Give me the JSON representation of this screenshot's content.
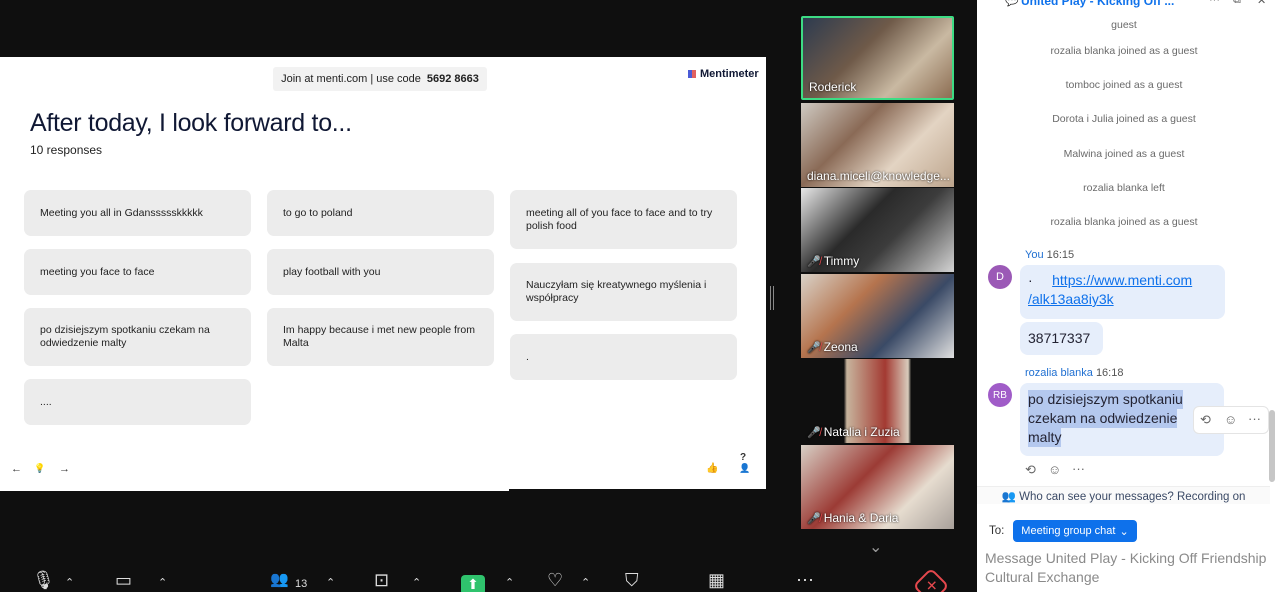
{
  "slide": {
    "join_text": "Join at menti.com | use code",
    "join_code": "5692 8663",
    "brand": "Mentimeter",
    "title": "After today, I look forward to...",
    "subtitle": "10 responses",
    "responses": [
      "Meeting you all in Gdanssssskkkkk",
      "meeting you face to face",
      "po dzisiejszym spotkaniu czekam na odwiedzenie malty",
      "....",
      "to go to poland",
      "play football with you",
      "Im happy because i met new people from Malta",
      "meeting all of you face to face and to try polish food",
      "Nauczyłam się kreatywnego myślenia i współpracy",
      "."
    ],
    "controls": {
      "prev": "←",
      "bulb": "💡",
      "next": "→",
      "like": "👍",
      "help": "?",
      "people": "👤"
    }
  },
  "participants": [
    {
      "name": "Roderick",
      "muted": false,
      "active": true
    },
    {
      "name": "diana.miceli@knowledge...",
      "muted": false,
      "active": false
    },
    {
      "name": "Timmy",
      "muted": true,
      "active": false
    },
    {
      "name": "Zeona",
      "muted": true,
      "active": false
    },
    {
      "name": "Natalia i Zuzia",
      "muted": true,
      "active": false
    },
    {
      "name": "Hania & Daria",
      "muted": true,
      "active": false
    }
  ],
  "chat": {
    "header_title": "United Play - Kicking Off ...",
    "system_messages": [
      "guest",
      "rozalia blanka joined as a guest",
      "tomboc joined as a guest",
      "Dorota i Julia joined as a guest",
      "Malwina joined as a guest",
      "rozalia blanka left",
      "rozalia blanka joined as a guest"
    ],
    "messages": [
      {
        "sender": "You",
        "time": "16:15",
        "avatar": "D",
        "avatar_color": "#9b59b6",
        "link_prefix": "·",
        "link": "https://www.menti.com/alk13aa8iy3k",
        "link_line1": "https://www.menti.com",
        "link_line2": "/alk13aa8iy3k",
        "text": "38717337"
      },
      {
        "sender": "rozalia blanka",
        "time": "16:18",
        "avatar": "RB",
        "avatar_color": "#a05cc8",
        "text_lines": [
          "po dzisiejszym spotkaniu",
          "czekam na odwiedzenie",
          "malty"
        ]
      }
    ],
    "privacy_text": "Who can see your messages? Recording on",
    "to_label": "To:",
    "to_target": "Meeting group chat",
    "input_placeholder": "Message United Play - Kicking Off Friendship Cultural Exchange"
  },
  "toolbar": {
    "participants_count": "13"
  },
  "colors": {
    "accent": "#0e71eb",
    "active_speaker": "#3ddc84",
    "share_green": "#2fc36d",
    "end_red": "#e5484d"
  }
}
